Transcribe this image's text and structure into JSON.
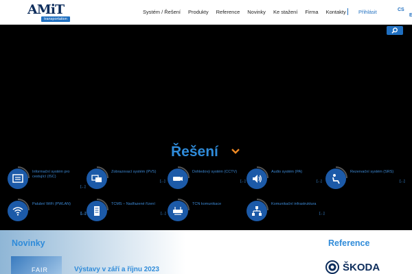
{
  "header": {
    "logo_text": "AMiT",
    "logo_tagline": "transportation",
    "nav": [
      "Systém / Řešení",
      "Produkty",
      "Reference",
      "Novinky",
      "Ke stažení",
      "Firma",
      "Kontakty"
    ],
    "login": "Přihlásit",
    "lang_cs": "CS",
    "lang_en": "EN"
  },
  "solutions": {
    "title": "Řešení",
    "more": "[...]",
    "items": [
      {
        "label": "Informační systém pro cestující (ISC)",
        "icon": "info-board-icon"
      },
      {
        "label": "Zobrazovací systém (PVS)",
        "icon": "displays-icon"
      },
      {
        "label": "Dohledový systém (CCTV)",
        "icon": "camera-icon"
      },
      {
        "label": "Audio systém (PA)",
        "icon": "speaker-icon"
      },
      {
        "label": "Rezervační systém (SRS)",
        "icon": "seat-icon"
      },
      {
        "label": "Palubní WiFi (PWLAN)",
        "icon": "wifi-icon"
      },
      {
        "label": "TCMS – Nadřazené řízení",
        "icon": "server-icon"
      },
      {
        "label": "TCN komunikace",
        "icon": "network-device-icon"
      },
      {
        "label": "Komunikační infrastruktura",
        "icon": "topology-icon"
      }
    ]
  },
  "news": {
    "title": "Novinky",
    "thumb_text": "FAIR",
    "headline": "Výstavy v září a říjnu 2023"
  },
  "references": {
    "title": "Reference",
    "logo_text": "ŠKODA"
  },
  "colors": {
    "accent": "#2f8bd9",
    "icon_bg": "#1c5aa8",
    "toggle": "#f08a24"
  }
}
